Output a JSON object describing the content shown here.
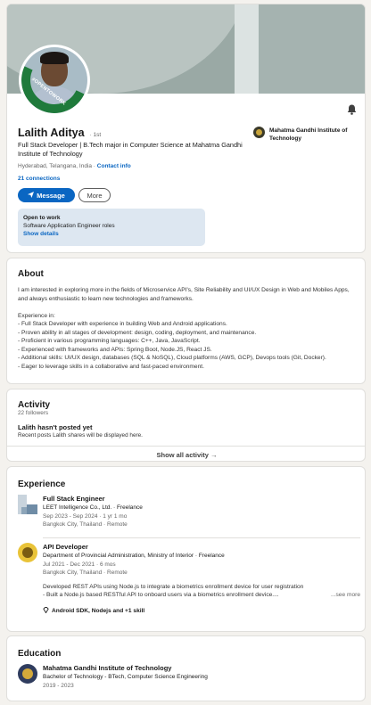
{
  "profile": {
    "name": "Lalith Aditya",
    "degree": "· 1st",
    "headline": "Full Stack Developer | B.Tech major in Computer Science at Mahatma Gandhi Institute of Technology",
    "location": "Hyderabad, Telangana, India ·",
    "contact_info": "Contact info",
    "connections": "21 connections",
    "message_button": "Message",
    "more_button": "More",
    "otw_badge": "#OPENTOWORK",
    "education_aside": "Mahatma Gandhi Institute of Technology",
    "open_to_work": {
      "title": "Open to work",
      "roles": "Software Application Engineer roles",
      "show_details": "Show details"
    }
  },
  "about": {
    "title": "About",
    "intro": "I am interested in exploring more in the fields of Microservice API's, Site Reliability and UI/UX Design in Web and Mobiles Apps, and always enthusiastic to learn new technologies and frameworks.",
    "experience_heading": "Experience in:",
    "bullets": [
      "- Full Stack Developer with experience in building Web and Android applications.",
      "- Proven ability in all stages of development: design, coding, deployment, and maintenance.",
      "- Proficient in various programming languages: C++, Java, JavaScript.",
      "- Experienced with frameworks and APIs: Spring Boot, Node.JS, React JS.",
      "- Additional skills: UI/UX design, databases (SQL & NoSQL), Cloud platforms (AWS, GCP), Devops tools (Git, Docker).",
      "- Eager to leverage skills in a collaborative and fast-paced environment."
    ]
  },
  "activity": {
    "title": "Activity",
    "followers": "22 followers",
    "empty_title": "Lalith hasn't posted yet",
    "empty_sub": "Recent posts Lalith shares will be displayed here.",
    "show_all": "Show all activity →"
  },
  "experience": {
    "title": "Experience",
    "items": [
      {
        "role": "Full Stack Engineer",
        "company": "LEET Intelligence Co., Ltd. · Freelance",
        "dates": "Sep 2023 - Sep 2024 · 1 yr 1 mo",
        "location": "Bangkok City, Thailand · Remote"
      },
      {
        "role": "API Developer",
        "company": "Department of Provincial Administration, Ministry of Interior · Freelance",
        "dates": "Jul 2021 - Dec 2021 · 6 mos",
        "location": "Bangkok City, Thailand · Remote",
        "desc1": "Developed REST APIs using Node.js to integrate a biometrics enrollment device for user registration",
        "desc2": "- Built a Node.js based RESTful API to onboard users via a biometrics enrollment device....",
        "see_more": "...see more",
        "skills": "Android SDK, Nodejs and +1 skill"
      }
    ]
  },
  "education": {
    "title": "Education",
    "school": "Mahatma Gandhi Institute of Technology",
    "degree": "Bachelor of Technology - BTech, Computer Science Engineering",
    "years": "2019 - 2023"
  },
  "colors": {
    "accent": "#0a66c2",
    "open_to_work_green": "#1f7a3b",
    "banner": "#9aa9a5",
    "page_bg": "#f4f2ee"
  }
}
